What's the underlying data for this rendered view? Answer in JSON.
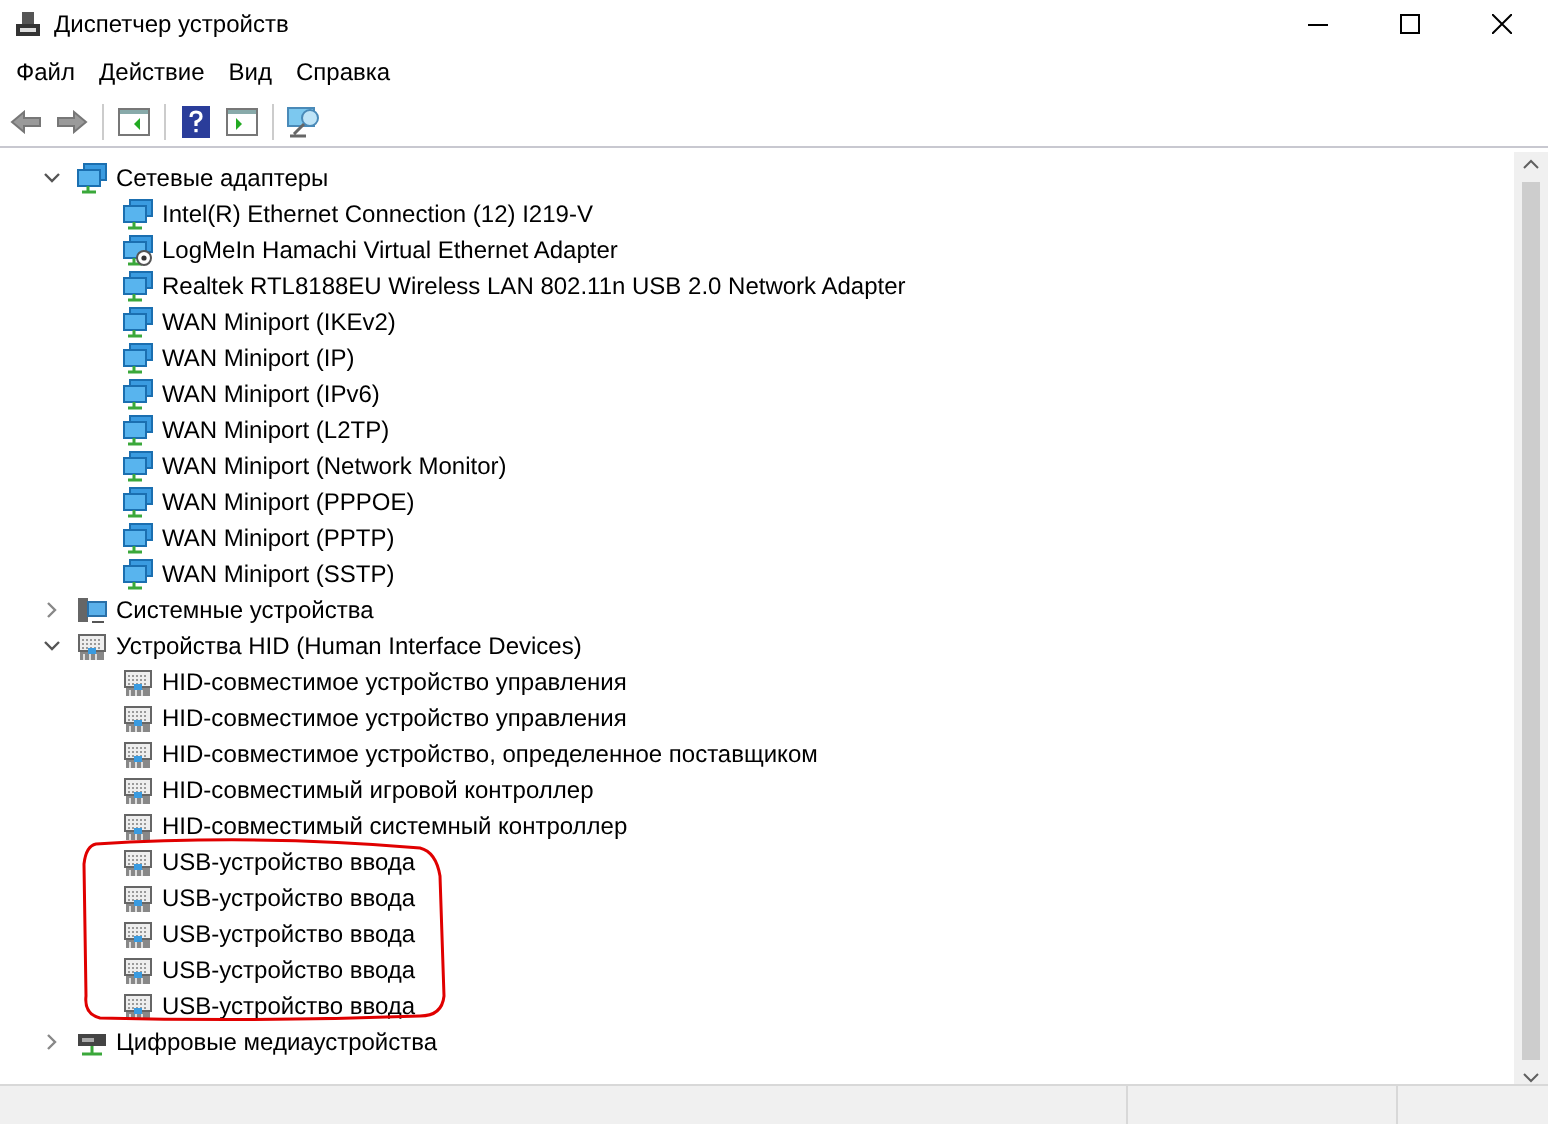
{
  "window": {
    "title": "Диспетчер устройств"
  },
  "menu": [
    "Файл",
    "Действие",
    "Вид",
    "Справка"
  ],
  "tree": [
    {
      "label": "Сетевые адаптеры",
      "kind": "network",
      "expanded": true,
      "children": [
        {
          "label": "Intel(R) Ethernet Connection (12) I219-V",
          "kind": "network"
        },
        {
          "label": "LogMeIn Hamachi Virtual Ethernet Adapter",
          "kind": "network-badge"
        },
        {
          "label": "Realtek RTL8188EU Wireless LAN 802.11n USB 2.0 Network Adapter",
          "kind": "network"
        },
        {
          "label": "WAN Miniport (IKEv2)",
          "kind": "network"
        },
        {
          "label": "WAN Miniport (IP)",
          "kind": "network"
        },
        {
          "label": "WAN Miniport (IPv6)",
          "kind": "network"
        },
        {
          "label": "WAN Miniport (L2TP)",
          "kind": "network"
        },
        {
          "label": "WAN Miniport (Network Monitor)",
          "kind": "network"
        },
        {
          "label": "WAN Miniport (PPPOE)",
          "kind": "network"
        },
        {
          "label": "WAN Miniport (PPTP)",
          "kind": "network"
        },
        {
          "label": "WAN Miniport (SSTP)",
          "kind": "network"
        }
      ]
    },
    {
      "label": "Системные устройства",
      "kind": "system",
      "expanded": false
    },
    {
      "label": "Устройства HID (Human Interface Devices)",
      "kind": "hid",
      "expanded": true,
      "children": [
        {
          "label": "HID-совместимое устройство управления",
          "kind": "hid"
        },
        {
          "label": "HID-совместимое устройство управления",
          "kind": "hid"
        },
        {
          "label": "HID-совместимое устройство, определенное поставщиком",
          "kind": "hid"
        },
        {
          "label": "HID-совместимый игровой контроллер",
          "kind": "hid"
        },
        {
          "label": "HID-совместимый системный контроллер",
          "kind": "hid"
        },
        {
          "label": "USB-устройство ввода",
          "kind": "hid"
        },
        {
          "label": "USB-устройство ввода",
          "kind": "hid"
        },
        {
          "label": "USB-устройство ввода",
          "kind": "hid"
        },
        {
          "label": "USB-устройство ввода",
          "kind": "hid"
        },
        {
          "label": "USB-устройство ввода",
          "kind": "hid"
        }
      ]
    },
    {
      "label": "Цифровые медиаустройства",
      "kind": "media",
      "expanded": false
    }
  ]
}
